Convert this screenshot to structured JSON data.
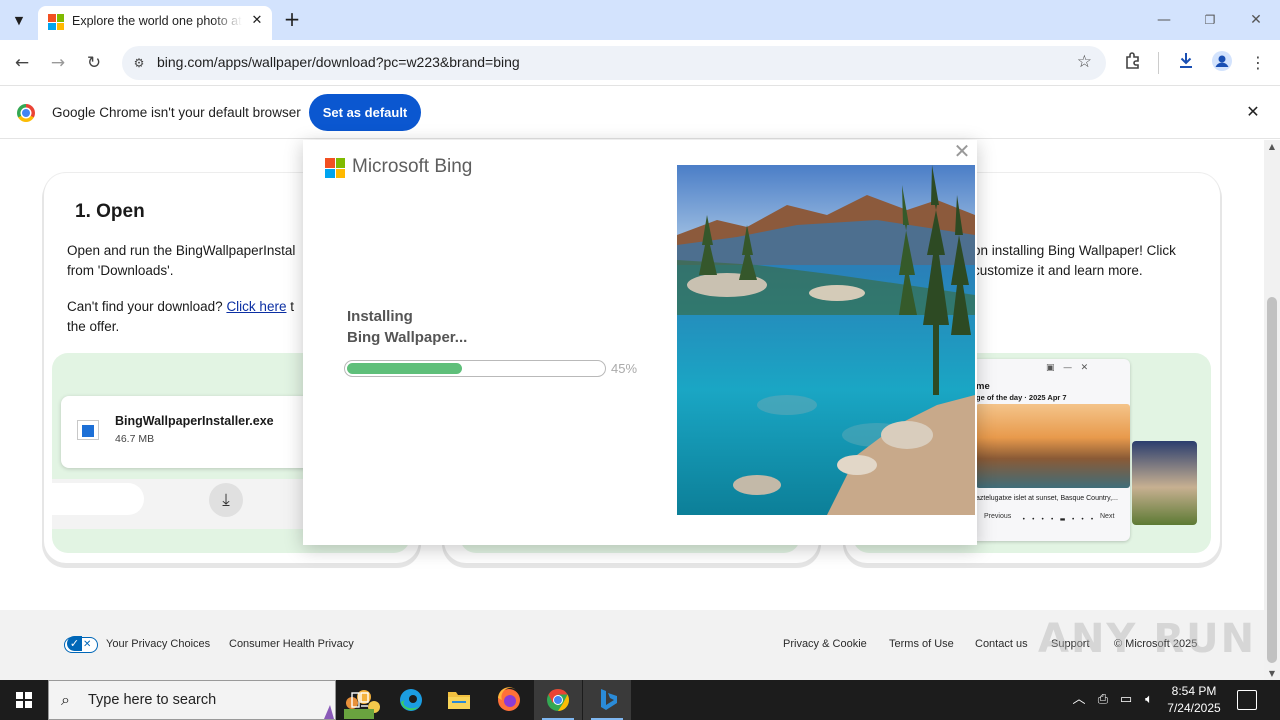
{
  "browser": {
    "tab_title": "Explore the world one photo at a time",
    "url": "bing.com/apps/wallpaper/download?pc=w223&brand=bing",
    "new_tab": "+",
    "tab_close": "✕"
  },
  "infobar": {
    "message": "Google Chrome isn't your default browser",
    "button_label": "Set as default",
    "close": "✕"
  },
  "page": {
    "card1": {
      "title": "1. Open",
      "text_line1": "Open and run the BingWallpaperInstal",
      "text_line2": "from 'Downloads'.",
      "text_q": "Can't find your download? ",
      "link": "Click here",
      "text_after_link": " t",
      "text_line4": "the offer.",
      "download_name": "BingWallpaperInstaller.exe",
      "download_size": "46.7 MB"
    },
    "card3": {
      "text_line1": "on installing Bing Wallpaper! Click",
      "text_line2": "customize it and learn more.",
      "mini_title": "me",
      "mini_subtitle": "ge of the day · 2025 Apr 7",
      "mini_caption": "aztelugatxe islet at sunset, Basque Country,...",
      "mini_prev": "Previous",
      "mini_next": "Next",
      "mini_dots": "• • • • ▬ • • •"
    }
  },
  "dialog": {
    "brand": "Microsoft Bing",
    "status_line1": "Installing",
    "status_line2": "Bing Wallpaper...",
    "progress_percent": 45,
    "progress_label": "45%",
    "close": "✕"
  },
  "footer": {
    "privacy_choices": "Your Privacy Choices",
    "consumer_health": "Consumer Health Privacy",
    "privacy_cookie": "Privacy & Cookie",
    "terms": "Terms of Use",
    "contact": "Contact us",
    "support": "Support",
    "copyright": "© Microsoft 2025"
  },
  "taskbar": {
    "search_placeholder": "Type here to search",
    "time": "8:54 PM",
    "date": "7/24/2025"
  },
  "watermark": "ANY RUN",
  "colors": {
    "tabstrip": "#d3e3fd",
    "chrome_blue": "#0b57d0",
    "progress_green": "#5fbf7a",
    "card_green": "#e2f4e3",
    "taskbar": "#1c1c1c"
  }
}
